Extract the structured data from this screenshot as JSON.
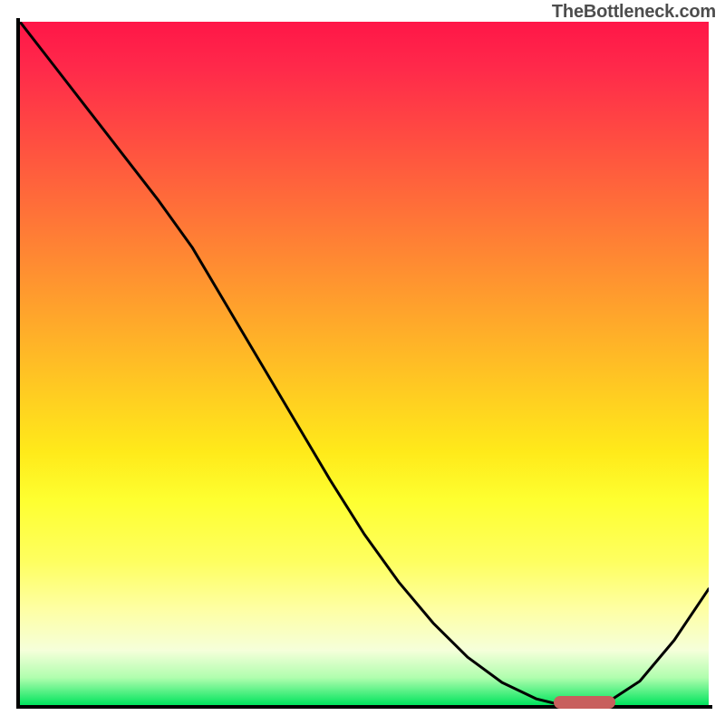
{
  "watermark": "TheBottleneck.com",
  "colors": {
    "axis": "#000000",
    "curve": "#000000",
    "marker": "#c85f5d",
    "gradient_top": "#ff1648",
    "gradient_bottom": "#00e45d"
  },
  "chart_data": {
    "type": "line",
    "title": "",
    "xlabel": "",
    "ylabel": "",
    "xlim": [
      0,
      100
    ],
    "ylim": [
      0,
      100
    ],
    "x": [
      0,
      5,
      10,
      15,
      20,
      25,
      30,
      35,
      40,
      45,
      50,
      55,
      60,
      65,
      70,
      75,
      78,
      80,
      82,
      85,
      90,
      95,
      100
    ],
    "values": [
      100,
      93.5,
      87,
      80.5,
      74,
      67,
      58.5,
      50,
      41.5,
      33,
      25,
      18,
      12,
      7,
      3.3,
      0.9,
      0.15,
      0.1,
      0.1,
      0.2,
      3.5,
      9.5,
      17
    ],
    "marker": {
      "x_start": 77.5,
      "x_end": 86.5,
      "y": 0.4
    },
    "grid": false,
    "legend": false,
    "annotations": []
  }
}
